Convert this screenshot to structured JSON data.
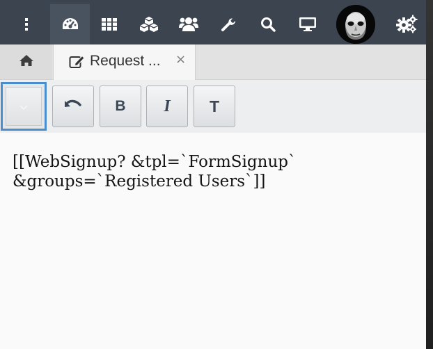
{
  "topbar": {
    "items": [
      {
        "icon": "vertical-ellipsis-icon"
      },
      {
        "icon": "dashboard-icon",
        "active": true
      },
      {
        "icon": "grid-icon"
      },
      {
        "icon": "cubes-icon"
      },
      {
        "icon": "users-icon"
      },
      {
        "icon": "wrench-icon"
      },
      {
        "icon": "search-icon"
      },
      {
        "icon": "desktop-icon"
      },
      {
        "icon": "avatar"
      },
      {
        "icon": "gears-icon"
      }
    ],
    "bar_color": "#3c4450",
    "active_color": "#49525f"
  },
  "tabs": {
    "home_icon": "home-icon",
    "active_tab": {
      "icon": "edit-icon",
      "label": "Request ...",
      "close": "×"
    }
  },
  "toolbar": {
    "select_value": "",
    "buttons": [
      {
        "icon": "undo-icon",
        "label": ""
      },
      {
        "icon": "bold-icon",
        "label": "B"
      },
      {
        "icon": "italic-icon",
        "label": "I"
      },
      {
        "icon": "text-icon",
        "label": "T"
      }
    ],
    "focus_color": "#4a8dcf"
  },
  "editor": {
    "content": "[[WebSignup? &tpl=`FormSignup`\n&groups=`Registered Users`]]"
  }
}
